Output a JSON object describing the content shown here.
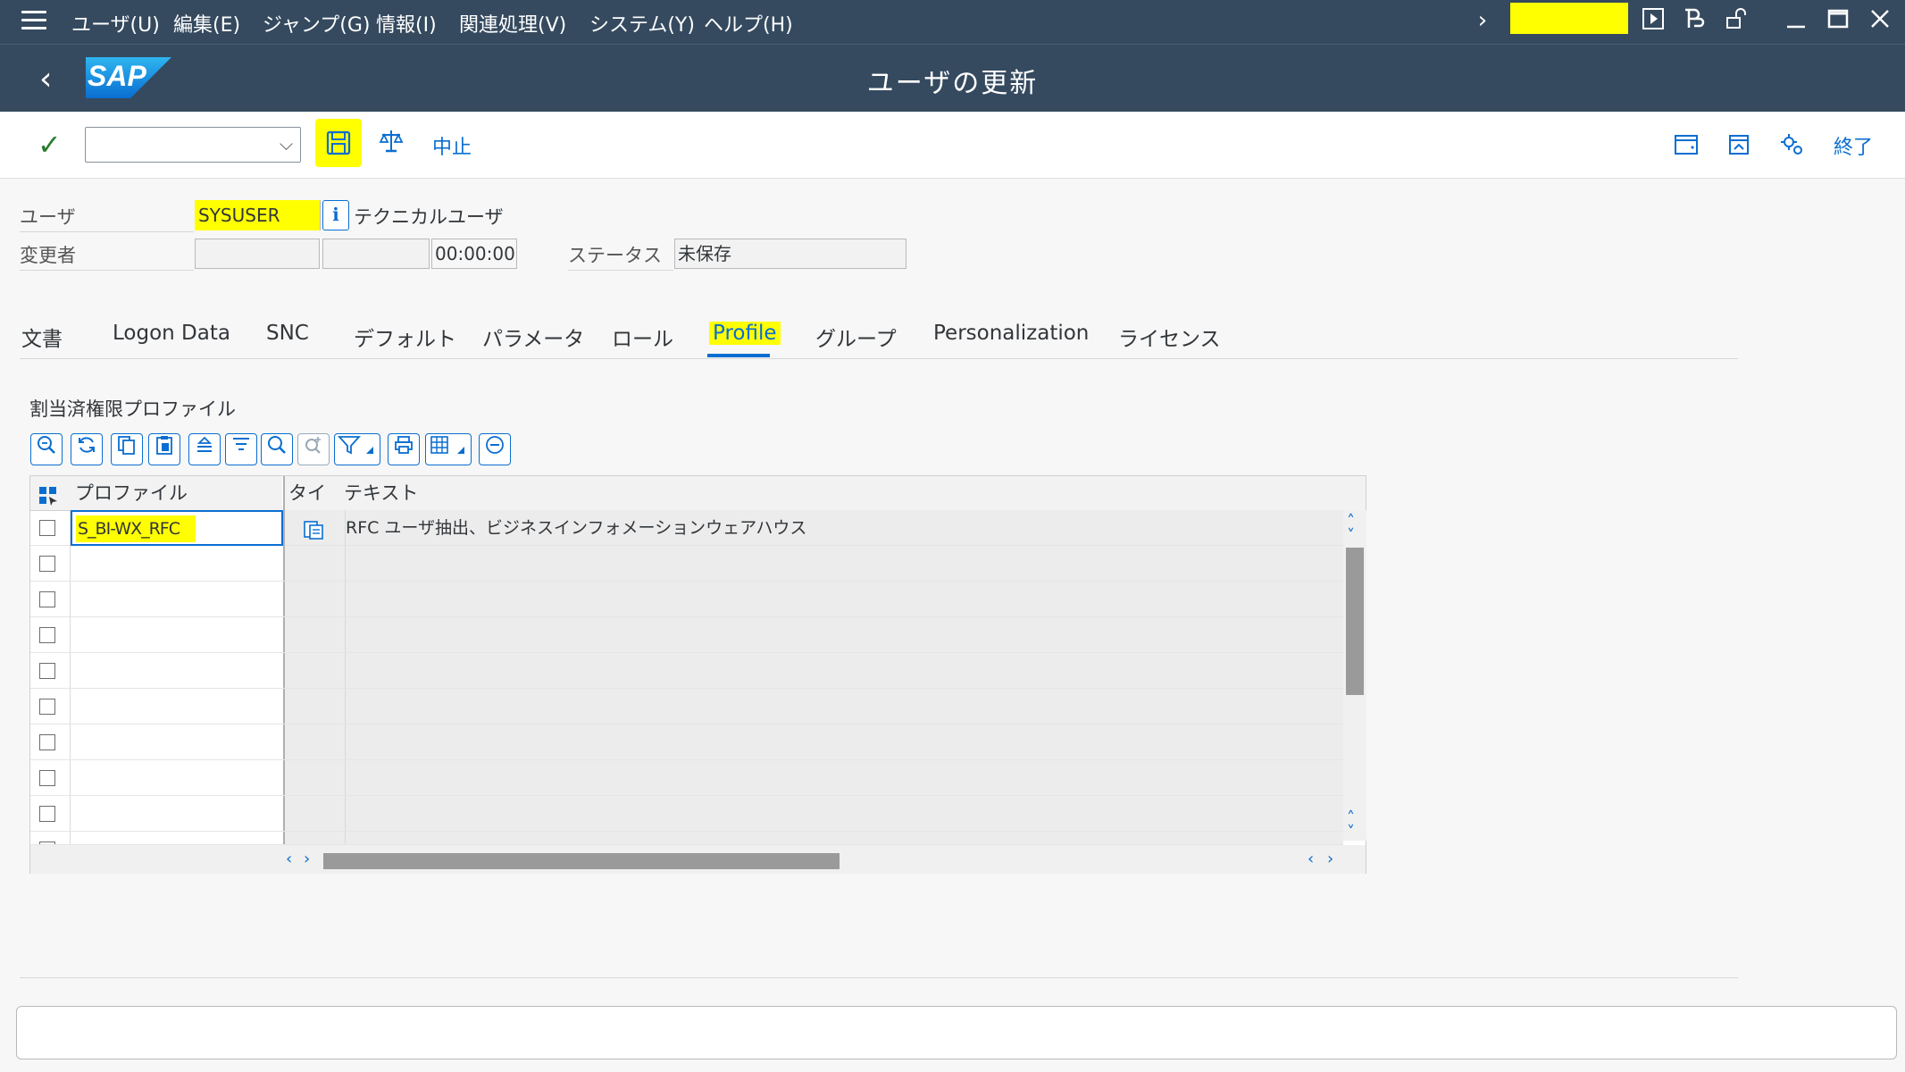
{
  "menu": {
    "items": [
      "ユーザ(U)",
      "編集(E)",
      "ジャンプ(G)",
      "情報(I)",
      "関連処理(V)",
      "システム(Y)",
      "ヘルプ(H)"
    ]
  },
  "title_bar": {
    "logo_text": "SAP",
    "title": "ユーザの更新"
  },
  "toolbar": {
    "cancel_label": "中止",
    "exit_label": "終了"
  },
  "header": {
    "user_label": "ユーザ",
    "user_value": "SYSUSER",
    "user_type_text": "テクニカルユーザ",
    "changed_by_label": "変更者",
    "changed_time": "00:00:00",
    "status_label": "ステータス",
    "status_value": "未保存"
  },
  "tabs": [
    "文書",
    "Logon Data",
    "SNC",
    "デフォルト",
    "パラメータ",
    "ロール",
    "Profile",
    "グループ",
    "Personalization",
    "ライセンス"
  ],
  "active_tab": "Profile",
  "profiles": {
    "section_title": "割当済権限プロファイル",
    "columns": [
      "プロファイル",
      "タイプ",
      "テキスト"
    ],
    "rows": [
      {
        "profile": "S_BI-WX_RFC",
        "text": "RFC ユーザ抽出、ビジネスインフォメーションウェアハウス"
      }
    ]
  },
  "colors": {
    "shell": "#354a5f",
    "accent": "#0a6ed1",
    "highlight": "#ffff00"
  }
}
